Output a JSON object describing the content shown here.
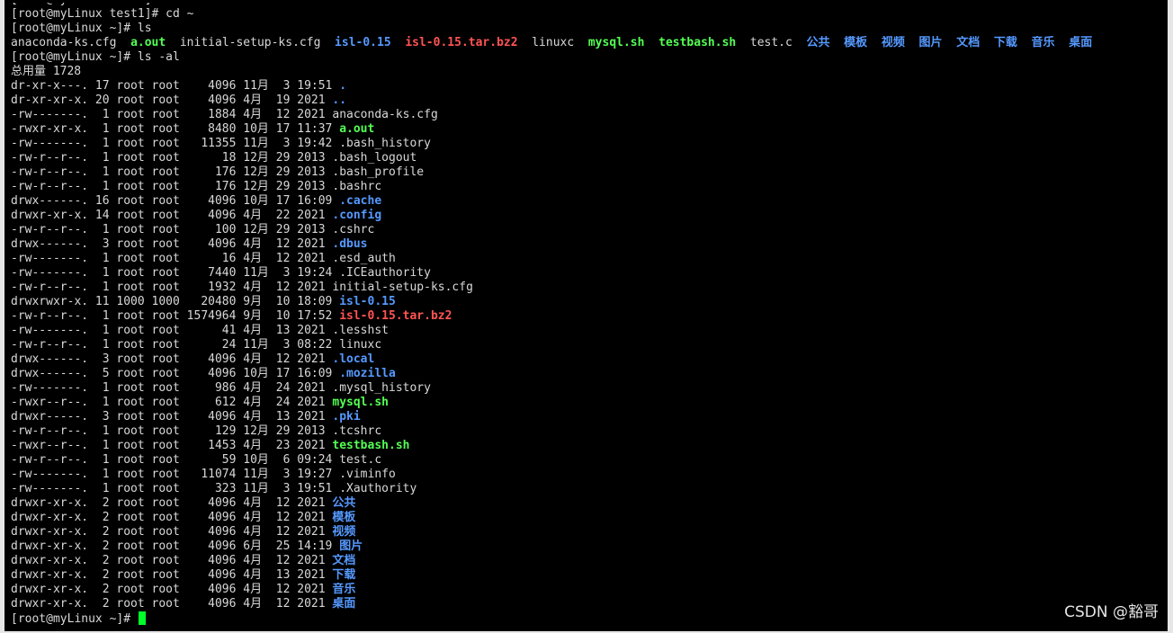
{
  "colors": {
    "background": "#000000",
    "text": "#d8d8d8",
    "executable": "#54ff54",
    "directory": "#5599ff",
    "archive": "#ff5454",
    "cursor": "#00ff2a",
    "frame": "#e6e6e6"
  },
  "lines": [
    [
      {
        "t": "[root@myLinux test1]# cd ~",
        "c": "plain"
      }
    ],
    [
      {
        "t": "[root@myLinux test1]# cd ~",
        "c": "plain"
      }
    ],
    [
      {
        "t": "[root@myLinux ~]# ls",
        "c": "plain"
      }
    ],
    [
      {
        "t": "anaconda-ks.cfg  ",
        "c": "plain"
      },
      {
        "t": "a.out",
        "c": "exec"
      },
      {
        "t": "  initial-setup-ks.cfg  ",
        "c": "plain"
      },
      {
        "t": "isl-0.15",
        "c": "dir"
      },
      {
        "t": "  ",
        "c": "plain"
      },
      {
        "t": "isl-0.15.tar.bz2",
        "c": "archive"
      },
      {
        "t": "  linuxc  ",
        "c": "plain"
      },
      {
        "t": "mysql.sh",
        "c": "exec"
      },
      {
        "t": "  ",
        "c": "plain"
      },
      {
        "t": "testbash.sh",
        "c": "exec"
      },
      {
        "t": "  test.c  ",
        "c": "plain"
      },
      {
        "t": "公共",
        "c": "dir"
      },
      {
        "t": "  ",
        "c": "plain"
      },
      {
        "t": "模板",
        "c": "dir"
      },
      {
        "t": "  ",
        "c": "plain"
      },
      {
        "t": "视频",
        "c": "dir"
      },
      {
        "t": "  ",
        "c": "plain"
      },
      {
        "t": "图片",
        "c": "dir"
      },
      {
        "t": "  ",
        "c": "plain"
      },
      {
        "t": "文档",
        "c": "dir"
      },
      {
        "t": "  ",
        "c": "plain"
      },
      {
        "t": "下载",
        "c": "dir"
      },
      {
        "t": "  ",
        "c": "plain"
      },
      {
        "t": "音乐",
        "c": "dir"
      },
      {
        "t": "  ",
        "c": "plain"
      },
      {
        "t": "桌面",
        "c": "dir"
      }
    ],
    [
      {
        "t": "[root@myLinux ~]# ls -al",
        "c": "plain"
      }
    ],
    [
      {
        "t": "总用量 1728",
        "c": "plain"
      }
    ],
    [
      {
        "t": "dr-xr-x---. 17 root root    4096 11月  3 19:51 ",
        "c": "plain"
      },
      {
        "t": ".",
        "c": "dir"
      }
    ],
    [
      {
        "t": "dr-xr-xr-x. 20 root root    4096 4月  19 2021 ",
        "c": "plain"
      },
      {
        "t": "..",
        "c": "dir"
      }
    ],
    [
      {
        "t": "-rw-------.  1 root root    1884 4月  12 2021 anaconda-ks.cfg",
        "c": "plain"
      }
    ],
    [
      {
        "t": "-rwxr-xr-x.  1 root root    8480 10月 17 11:37 ",
        "c": "plain"
      },
      {
        "t": "a.out",
        "c": "exec"
      }
    ],
    [
      {
        "t": "-rw-------.  1 root root   11355 11月  3 19:42 .bash_history",
        "c": "plain"
      }
    ],
    [
      {
        "t": "-rw-r--r--.  1 root root      18 12月 29 2013 .bash_logout",
        "c": "plain"
      }
    ],
    [
      {
        "t": "-rw-r--r--.  1 root root     176 12月 29 2013 .bash_profile",
        "c": "plain"
      }
    ],
    [
      {
        "t": "-rw-r--r--.  1 root root     176 12月 29 2013 .bashrc",
        "c": "plain"
      }
    ],
    [
      {
        "t": "drwx------. 16 root root    4096 10月 17 16:09 ",
        "c": "plain"
      },
      {
        "t": ".cache",
        "c": "dir"
      }
    ],
    [
      {
        "t": "drwxr-xr-x. 14 root root    4096 4月  22 2021 ",
        "c": "plain"
      },
      {
        "t": ".config",
        "c": "dir"
      }
    ],
    [
      {
        "t": "-rw-r--r--.  1 root root     100 12月 29 2013 .cshrc",
        "c": "plain"
      }
    ],
    [
      {
        "t": "drwx------.  3 root root    4096 4月  12 2021 ",
        "c": "plain"
      },
      {
        "t": ".dbus",
        "c": "dir"
      }
    ],
    [
      {
        "t": "-rw-------.  1 root root      16 4月  12 2021 .esd_auth",
        "c": "plain"
      }
    ],
    [
      {
        "t": "-rw-------.  1 root root    7440 11月  3 19:24 .ICEauthority",
        "c": "plain"
      }
    ],
    [
      {
        "t": "-rw-r--r--.  1 root root    1932 4月  12 2021 initial-setup-ks.cfg",
        "c": "plain"
      }
    ],
    [
      {
        "t": "drwxrwxr-x. 11 1000 1000   20480 9月  10 18:09 ",
        "c": "plain"
      },
      {
        "t": "isl-0.15",
        "c": "dir"
      }
    ],
    [
      {
        "t": "-rw-r--r--.  1 root root 1574964 9月  10 17:52 ",
        "c": "plain"
      },
      {
        "t": "isl-0.15.tar.bz2",
        "c": "archive"
      }
    ],
    [
      {
        "t": "-rw-------.  1 root root      41 4月  13 2021 .lesshst",
        "c": "plain"
      }
    ],
    [
      {
        "t": "-rw-r--r--.  1 root root      24 11月  3 08:22 linuxc",
        "c": "plain"
      }
    ],
    [
      {
        "t": "drwx------.  3 root root    4096 4月  12 2021 ",
        "c": "plain"
      },
      {
        "t": ".local",
        "c": "dir"
      }
    ],
    [
      {
        "t": "drwx------.  5 root root    4096 10月 17 16:09 ",
        "c": "plain"
      },
      {
        "t": ".mozilla",
        "c": "dir"
      }
    ],
    [
      {
        "t": "-rw-------.  1 root root     986 4月  24 2021 .mysql_history",
        "c": "plain"
      }
    ],
    [
      {
        "t": "-rwxr--r--.  1 root root     612 4月  24 2021 ",
        "c": "plain"
      },
      {
        "t": "mysql.sh",
        "c": "exec"
      }
    ],
    [
      {
        "t": "drwxr-----.  3 root root    4096 4月  13 2021 ",
        "c": "plain"
      },
      {
        "t": ".pki",
        "c": "dir"
      }
    ],
    [
      {
        "t": "-rw-r--r--.  1 root root     129 12月 29 2013 .tcshrc",
        "c": "plain"
      }
    ],
    [
      {
        "t": "-rwxr--r--.  1 root root    1453 4月  23 2021 ",
        "c": "plain"
      },
      {
        "t": "testbash.sh",
        "c": "exec"
      }
    ],
    [
      {
        "t": "-rw-r--r--.  1 root root      59 10月  6 09:24 test.c",
        "c": "plain"
      }
    ],
    [
      {
        "t": "-rw-------.  1 root root   11074 11月  3 19:27 .viminfo",
        "c": "plain"
      }
    ],
    [
      {
        "t": "-rw-------.  1 root root     323 11月  3 19:51 .Xauthority",
        "c": "plain"
      }
    ],
    [
      {
        "t": "drwxr-xr-x.  2 root root    4096 4月  12 2021 ",
        "c": "plain"
      },
      {
        "t": "公共",
        "c": "dir"
      }
    ],
    [
      {
        "t": "drwxr-xr-x.  2 root root    4096 4月  12 2021 ",
        "c": "plain"
      },
      {
        "t": "模板",
        "c": "dir"
      }
    ],
    [
      {
        "t": "drwxr-xr-x.  2 root root    4096 4月  12 2021 ",
        "c": "plain"
      },
      {
        "t": "视频",
        "c": "dir"
      }
    ],
    [
      {
        "t": "drwxr-xr-x.  2 root root    4096 6月  25 14:19 ",
        "c": "plain"
      },
      {
        "t": "图片",
        "c": "dir"
      }
    ],
    [
      {
        "t": "drwxr-xr-x.  2 root root    4096 4月  12 2021 ",
        "c": "plain"
      },
      {
        "t": "文档",
        "c": "dir"
      }
    ],
    [
      {
        "t": "drwxr-xr-x.  2 root root    4096 4月  13 2021 ",
        "c": "plain"
      },
      {
        "t": "下载",
        "c": "dir"
      }
    ],
    [
      {
        "t": "drwxr-xr-x.  2 root root    4096 4月  12 2021 ",
        "c": "plain"
      },
      {
        "t": "音乐",
        "c": "dir"
      }
    ],
    [
      {
        "t": "drwxr-xr-x.  2 root root    4096 4月  12 2021 ",
        "c": "plain"
      },
      {
        "t": "桌面",
        "c": "dir"
      }
    ]
  ],
  "prompt": "[root@myLinux ~]# ",
  "watermark": "CSDN @豁哥"
}
